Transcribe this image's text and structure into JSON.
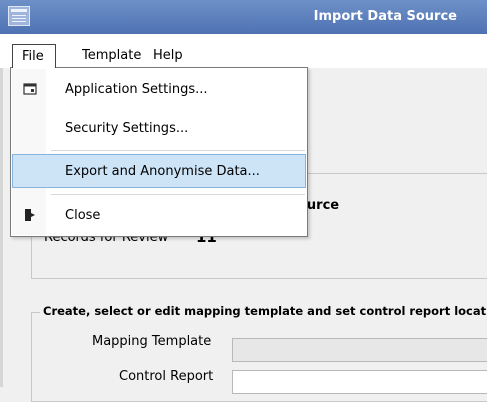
{
  "window": {
    "title": "Import Data Source"
  },
  "menubar": {
    "items": [
      "File",
      "Template",
      "Help"
    ]
  },
  "file_menu": {
    "items": [
      {
        "label": "Application Settings...",
        "icon": "settings-window-icon"
      },
      {
        "label": "Security Settings...",
        "icon": ""
      },
      {
        "label": "Export and Anonymise Data...",
        "icon": "",
        "highlighted": true
      },
      {
        "label": "Close",
        "icon": "exit-door-icon"
      }
    ]
  },
  "section1": {
    "title_partial": "ource",
    "records_label": "Records for Review",
    "records_value": "11"
  },
  "section2": {
    "title": "Create, select or edit mapping template and set control report locatio",
    "mapping_template_label": "Mapping Template",
    "control_report_label": "Control Report"
  }
}
